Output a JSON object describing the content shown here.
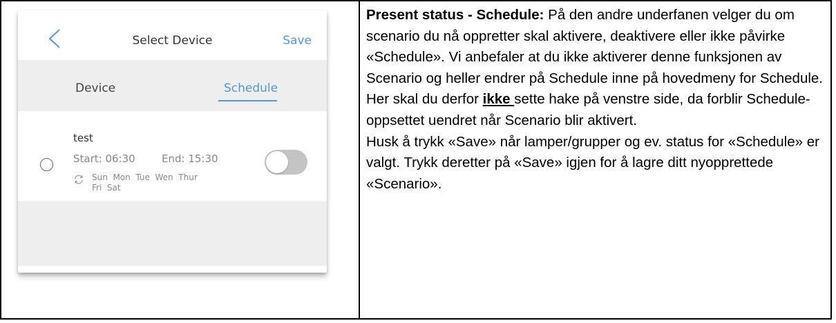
{
  "phone": {
    "title": "Select Device",
    "save_label": "Save",
    "tabs": [
      {
        "label": "Device",
        "active": false
      },
      {
        "label": "Schedule",
        "active": true
      }
    ],
    "schedule_item": {
      "name": "test",
      "start": "Start: 06:30",
      "end": "End: 15:30",
      "days_line1": "Sun  Mon  Tue  Wen  Thur",
      "days_line2": "Fri  Sat",
      "enabled": false
    },
    "accent_color": "#4a9bd6"
  },
  "text": {
    "heading": "Present status - Schedule:",
    "p1_rest": " På den andre underfanen velger du om scenario du nå oppretter skal aktivere, deaktivere eller ikke påvirke «Schedule». Vi anbefaler at du ikke aktiverer denne funksjonen av Scenario og heller endrer på Schedule inne på hovedmeny for Schedule.",
    "p2_before": "Her skal du derfor ",
    "p2_emphasis": "ikke ",
    "p2_after": "sette hake på venstre side, da forblir Schedule-oppsettet uendret når Scenario blir aktivert.",
    "p3": "Husk å trykk «Save» når lamper/grupper og ev. status for «Schedule» er valgt. Trykk deretter på «Save» igjen for å lagre ditt nyopprettede «Scenario»."
  }
}
